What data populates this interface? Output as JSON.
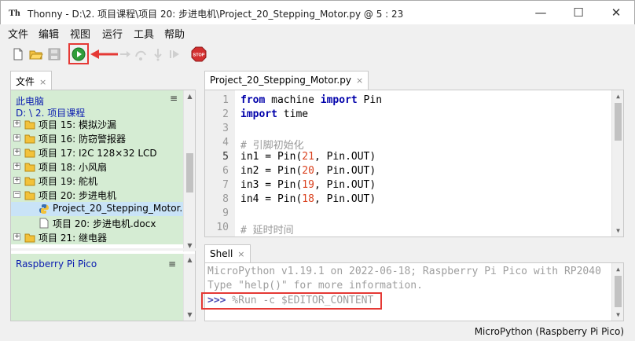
{
  "window": {
    "title": "Thonny  -  D:\\2. 项目课程\\项目 20: 步进电机\\Project_20_Stepping_Motor.py  @  5 : 23",
    "app_icon_text": "Th",
    "minimize": "—",
    "maximize": "☐",
    "close": "✕"
  },
  "menu": [
    "文件",
    "编辑",
    "视图",
    "运行",
    "工具",
    "帮助"
  ],
  "toolbar": {
    "buttons": [
      "new-file",
      "open-file",
      "save-file",
      "run",
      "debug",
      "step-over",
      "step-into",
      "step-out",
      "resume",
      "stop"
    ],
    "accent_color": "#e53935"
  },
  "files_panel": {
    "tab_label": "文件",
    "tab_close": "×",
    "header_line1": "此电脑",
    "header_line2": "D: \\ 2. 项目课程",
    "menu_glyph": "≡",
    "tree": [
      {
        "label": "项目 15: 模拟沙漏",
        "type": "folder",
        "expander": "+"
      },
      {
        "label": "项目 16: 防窃警报器",
        "type": "folder",
        "expander": "+"
      },
      {
        "label": "项目 17:  I2C 128×32 LCD",
        "type": "folder",
        "expander": "+"
      },
      {
        "label": "项目 18: 小风扇",
        "type": "folder",
        "expander": "+"
      },
      {
        "label": "项目 19: 舵机",
        "type": "folder",
        "expander": "+"
      },
      {
        "label": "项目 20: 步进电机",
        "type": "folder",
        "expander": "−"
      },
      {
        "label": "Project_20_Stepping_Motor.py",
        "type": "python-file",
        "expander": ""
      },
      {
        "label": "项目 20: 步进电机.docx",
        "type": "file",
        "expander": ""
      },
      {
        "label": "项目 21: 继电器",
        "type": "folder",
        "expander": "+"
      }
    ],
    "pico_label": "Raspberry Pi Pico",
    "pico_menu_glyph": "≡"
  },
  "editor": {
    "tab_label": "Project_20_Stepping_Motor.py",
    "tab_close": "×",
    "current_line": 5,
    "lines": [
      {
        "n": "1",
        "tokens": [
          [
            "kw",
            "from"
          ],
          [
            "t",
            " machine "
          ],
          [
            "kw",
            "import"
          ],
          [
            "t",
            " Pin"
          ]
        ]
      },
      {
        "n": "2",
        "tokens": [
          [
            "kw",
            "import"
          ],
          [
            "t",
            " time"
          ]
        ]
      },
      {
        "n": "3",
        "tokens": []
      },
      {
        "n": "4",
        "tokens": [
          [
            "cmt",
            "# 引脚初始化"
          ]
        ]
      },
      {
        "n": "5",
        "tokens": [
          [
            "t",
            "in1 = Pin("
          ],
          [
            "num",
            "21"
          ],
          [
            "t",
            ", Pin.OUT)"
          ]
        ]
      },
      {
        "n": "6",
        "tokens": [
          [
            "t",
            "in2 = Pin("
          ],
          [
            "num",
            "20"
          ],
          [
            "t",
            ", Pin.OUT)"
          ]
        ]
      },
      {
        "n": "7",
        "tokens": [
          [
            "t",
            "in3 = Pin("
          ],
          [
            "num",
            "19"
          ],
          [
            "t",
            ", Pin.OUT)"
          ]
        ]
      },
      {
        "n": "8",
        "tokens": [
          [
            "t",
            "in4 = Pin("
          ],
          [
            "num",
            "18"
          ],
          [
            "t",
            ", Pin.OUT)"
          ]
        ]
      },
      {
        "n": "9",
        "tokens": []
      },
      {
        "n": "10",
        "tokens": [
          [
            "cmt",
            "# 延时时间"
          ]
        ]
      }
    ]
  },
  "shell": {
    "tab_label": "Shell",
    "tab_close": "×",
    "banner1": "MicroPython v1.19.1 on 2022-06-18; Raspberry Pi Pico with RP2040",
    "banner2": "Type \"help()\" for more information.",
    "prompt": ">>>",
    "command": " %Run -c $EDITOR_CONTENT"
  },
  "status": {
    "interpreter": "MicroPython (Raspberry Pi Pico)"
  }
}
